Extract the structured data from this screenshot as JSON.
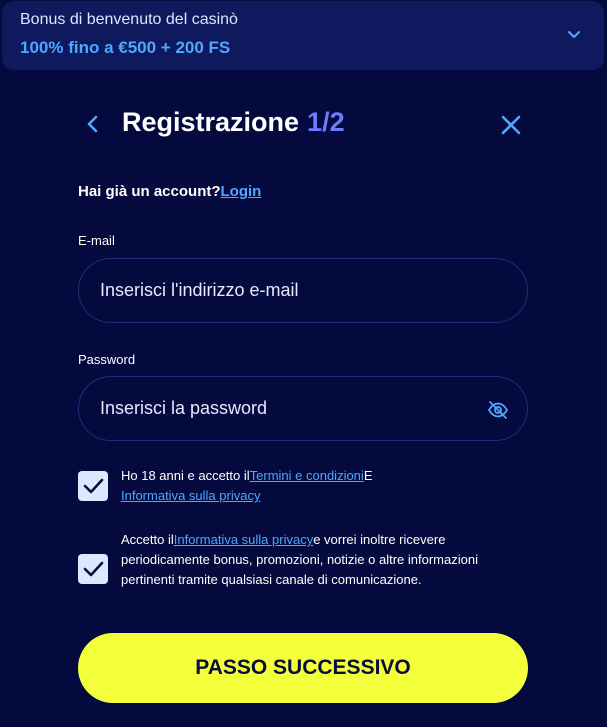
{
  "bonus": {
    "title": "Bonus di benvenuto del casinò",
    "amount": "100% fino a €500 + 200 FS",
    "toggle_icon": "chevron-down-icon"
  },
  "header": {
    "title": "Registrazione",
    "step": "1/2",
    "back_icon": "chevron-left-icon",
    "close_icon": "close-icon"
  },
  "login": {
    "prompt": "Hai già un account?",
    "link": "Login"
  },
  "form": {
    "email_label": "E-mail",
    "email_placeholder": "Inserisci l'indirizzo e-mail",
    "email_value": "",
    "password_label": "Password",
    "password_placeholder": "Inserisci la password",
    "password_value": "",
    "password_toggle_icon": "eye-off-icon"
  },
  "consents": [
    {
      "checked": true,
      "text_before": "Ho 18 anni e accetto il",
      "link1": "Termini e condizioni",
      "text_middle": "E",
      "link2": "Informativa sulla privacy"
    },
    {
      "checked": true,
      "text_before": "Accetto il",
      "link1": "Informativa sulla privacy",
      "text_after": "e vorrei inoltre ricevere periodicamente bonus, promozioni, notizie o altre informazioni pertinenti tramite qualsiasi canale di comunicazione."
    }
  ],
  "submit": {
    "label": "PASSO SUCCESSIVO"
  },
  "colors": {
    "background": "#040a3d",
    "panel": "#0f1a5e",
    "accent_blue": "#4fa7ff",
    "step_purple": "#6c7cff",
    "cta_yellow": "#f2ff3a",
    "checkbox": "#dbe8ff"
  }
}
